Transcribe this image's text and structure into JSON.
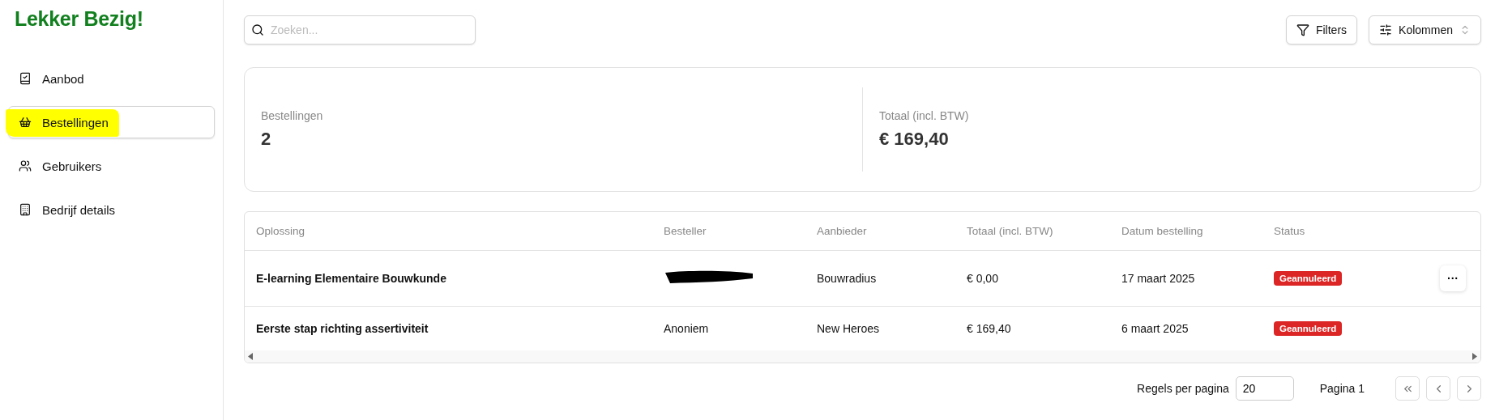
{
  "sidebar": {
    "logo": "Lekker Bezig!",
    "items": [
      {
        "label": "Aanbod",
        "selected": false,
        "highlighted": false
      },
      {
        "label": "Bestellingen",
        "selected": true,
        "highlighted": true
      },
      {
        "label": "Gebruikers",
        "selected": false,
        "highlighted": false
      },
      {
        "label": "Bedrijf details",
        "selected": false,
        "highlighted": false
      }
    ]
  },
  "toolbar": {
    "search": {
      "placeholder": "Zoeken..."
    },
    "buttons": [
      {
        "label": "Filters"
      },
      {
        "label": "Kolommen"
      }
    ]
  },
  "stats": [
    {
      "label": "Bestellingen",
      "value": "2"
    },
    {
      "label": "Totaal (incl. BTW)",
      "value": "€ 169,40"
    }
  ],
  "table": {
    "columns": [
      "Oplossing",
      "Besteller",
      "Aanbieder",
      "Totaal (incl. BTW)",
      "Datum bestelling",
      "Status"
    ],
    "rows": [
      {
        "cells": [
          "E-learning Elementaire Bouwkunde",
          null,
          "Bouwradius",
          "€ 0,00",
          "17 maart 2025"
        ],
        "besteller_redacted": true,
        "status": "Geannuleerd",
        "actions": "···"
      },
      {
        "cells": [
          "Eerste stap richting assertiviteit",
          "Anoniem",
          "New Heroes",
          "€ 169,40",
          "6 maart 2025"
        ],
        "besteller_redacted": false,
        "status": "Geannuleerd"
      }
    ]
  },
  "pagination": {
    "rows_label": "Regels per pagina",
    "rows_value": "20",
    "page": "Pagina 1"
  }
}
